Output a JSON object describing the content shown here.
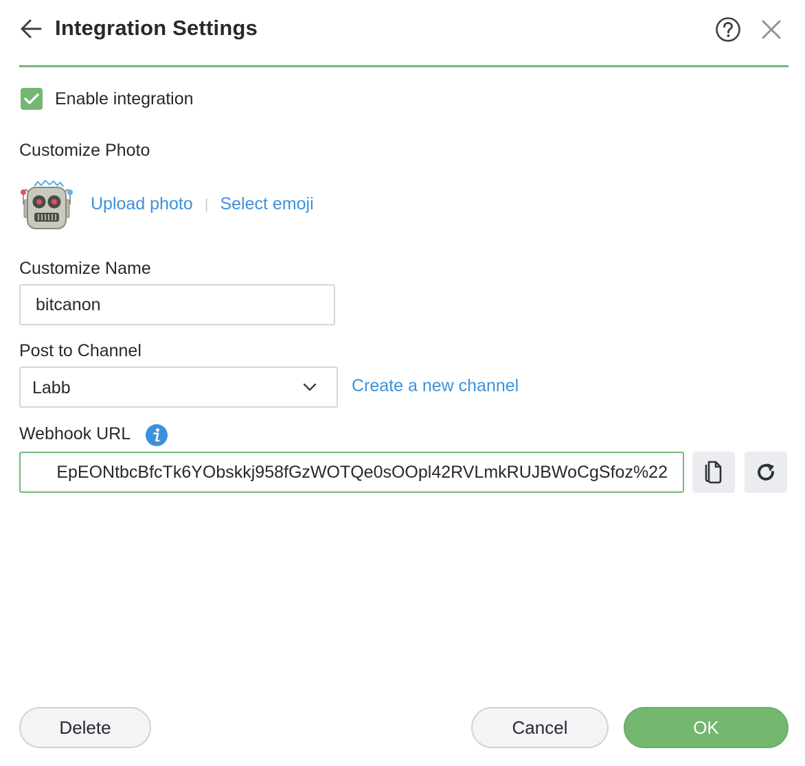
{
  "header": {
    "title": "Integration Settings",
    "back_icon": "arrow-left-icon",
    "help_icon": "question-circle-icon",
    "close_icon": "close-icon"
  },
  "enable": {
    "label": "Enable integration",
    "checked": true
  },
  "photo": {
    "label": "Customize Photo",
    "avatar_icon": "robot-face-icon",
    "upload_label": "Upload photo",
    "separator": "|",
    "emoji_label": "Select emoji"
  },
  "name": {
    "label": "Customize Name",
    "value": "bitcanon"
  },
  "channel": {
    "label": "Post to Channel",
    "selected": "Labb",
    "create_label": "Create a new channel"
  },
  "webhook": {
    "label": "Webhook URL",
    "info_icon": "info-icon",
    "value": "EpEONtbcBfcTk6YObskkj958fGzWOTQe0sOOpl42RVLmkRUJBWoCgSfoz%22",
    "copy_icon": "copy-icon",
    "regenerate_icon": "refresh-icon"
  },
  "footer": {
    "delete_label": "Delete",
    "cancel_label": "Cancel",
    "ok_label": "OK"
  },
  "colors": {
    "accent_green": "#73b771",
    "link_blue": "#3d91dc",
    "info_blue": "#3d91dc"
  }
}
